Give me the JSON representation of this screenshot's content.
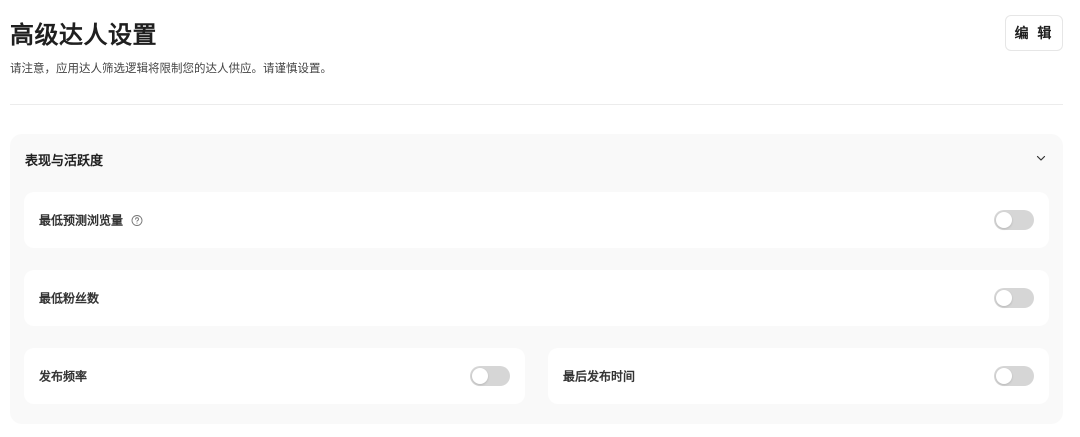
{
  "header": {
    "title": "高级达人设置",
    "subtitle": "请注意，应用达人筛选逻辑将限制您的达人供应。请谨慎设置。",
    "edit_label": "编 辑"
  },
  "section": {
    "title": "表现与活跃度",
    "expanded": true,
    "rows": [
      {
        "label": "最低预测浏览量",
        "has_help": true,
        "enabled": false
      },
      {
        "label": "最低粉丝数",
        "has_help": false,
        "enabled": false
      },
      {
        "label": "发布频率",
        "has_help": false,
        "enabled": false
      },
      {
        "label": "最后发布时间",
        "has_help": false,
        "enabled": false
      }
    ]
  },
  "colors": {
    "toggle_off": "#d6d6d6",
    "section_bg": "#f9f9f9",
    "row_bg": "#ffffff"
  },
  "icons": {
    "help": "help-circle-icon",
    "chevron": "chevron-down-icon"
  }
}
